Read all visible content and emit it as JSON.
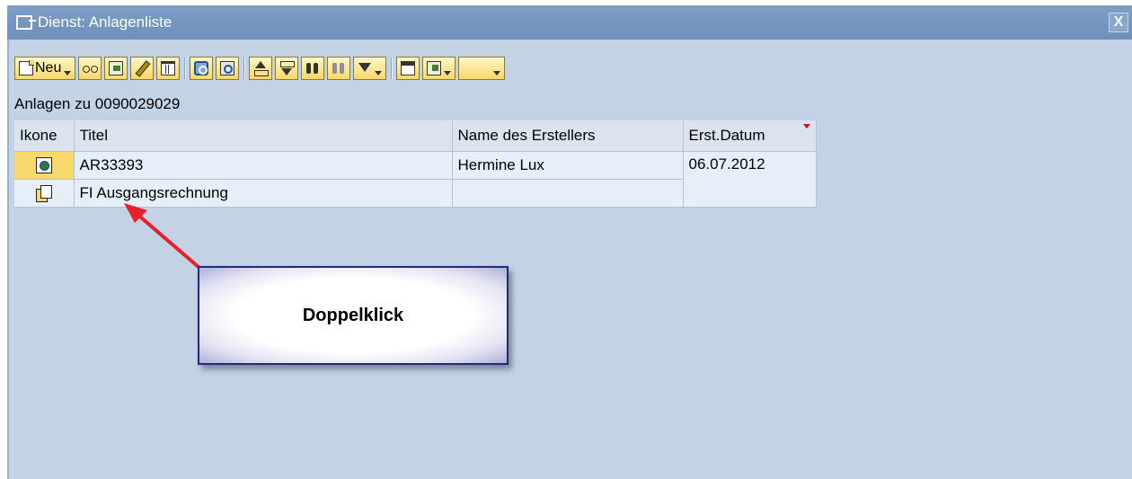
{
  "window": {
    "title": "Dienst: Anlagenliste",
    "close_label": "X"
  },
  "toolbar": {
    "new_label": "Neu"
  },
  "heading": "Anlagen zu 0090029029",
  "table": {
    "columns": [
      "Ikone",
      "Titel",
      "Name des Erstellers",
      "Erst.Datum"
    ],
    "rows": [
      {
        "icon": "pdf-document-icon",
        "titel": "AR33393",
        "ersteller": "Hermine Lux",
        "datum": "06.07.2012"
      },
      {
        "icon": "document-stack-icon",
        "titel": "FI Ausgangsrechnung",
        "ersteller": "",
        "datum": ""
      }
    ]
  },
  "annotation": {
    "callout_text": "Doppelklick"
  },
  "colors": {
    "titlebar": "#7e9fc5",
    "background": "#c3d2e4",
    "button": "#f6d86b",
    "arrow": "#e8202a",
    "callout_border": "#1f2a7a"
  }
}
